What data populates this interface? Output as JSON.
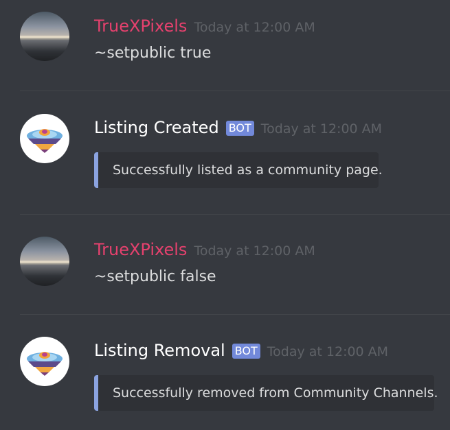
{
  "messages": [
    {
      "author": "TrueXPixels",
      "timestamp": "Today at 12:00 AM",
      "text": "~setpublic true"
    },
    {
      "author": "Listing Created",
      "bot_tag": "BOT",
      "timestamp": "Today at 12:00 AM",
      "embed_text": "Successfully listed as a community page."
    },
    {
      "author": "TrueXPixels",
      "timestamp": "Today at 12:00 AM",
      "text": "~setpublic false"
    },
    {
      "author": "Listing Removal",
      "bot_tag": "BOT",
      "timestamp": "Today at 12:00 AM",
      "embed_text": "Successfully removed from Community Channels."
    }
  ],
  "colors": {
    "background": "#36393f",
    "user_name": "#e6416e",
    "bot_tag": "#7289da",
    "embed_border": "#8ba3e0",
    "embed_background": "#2f3136"
  }
}
